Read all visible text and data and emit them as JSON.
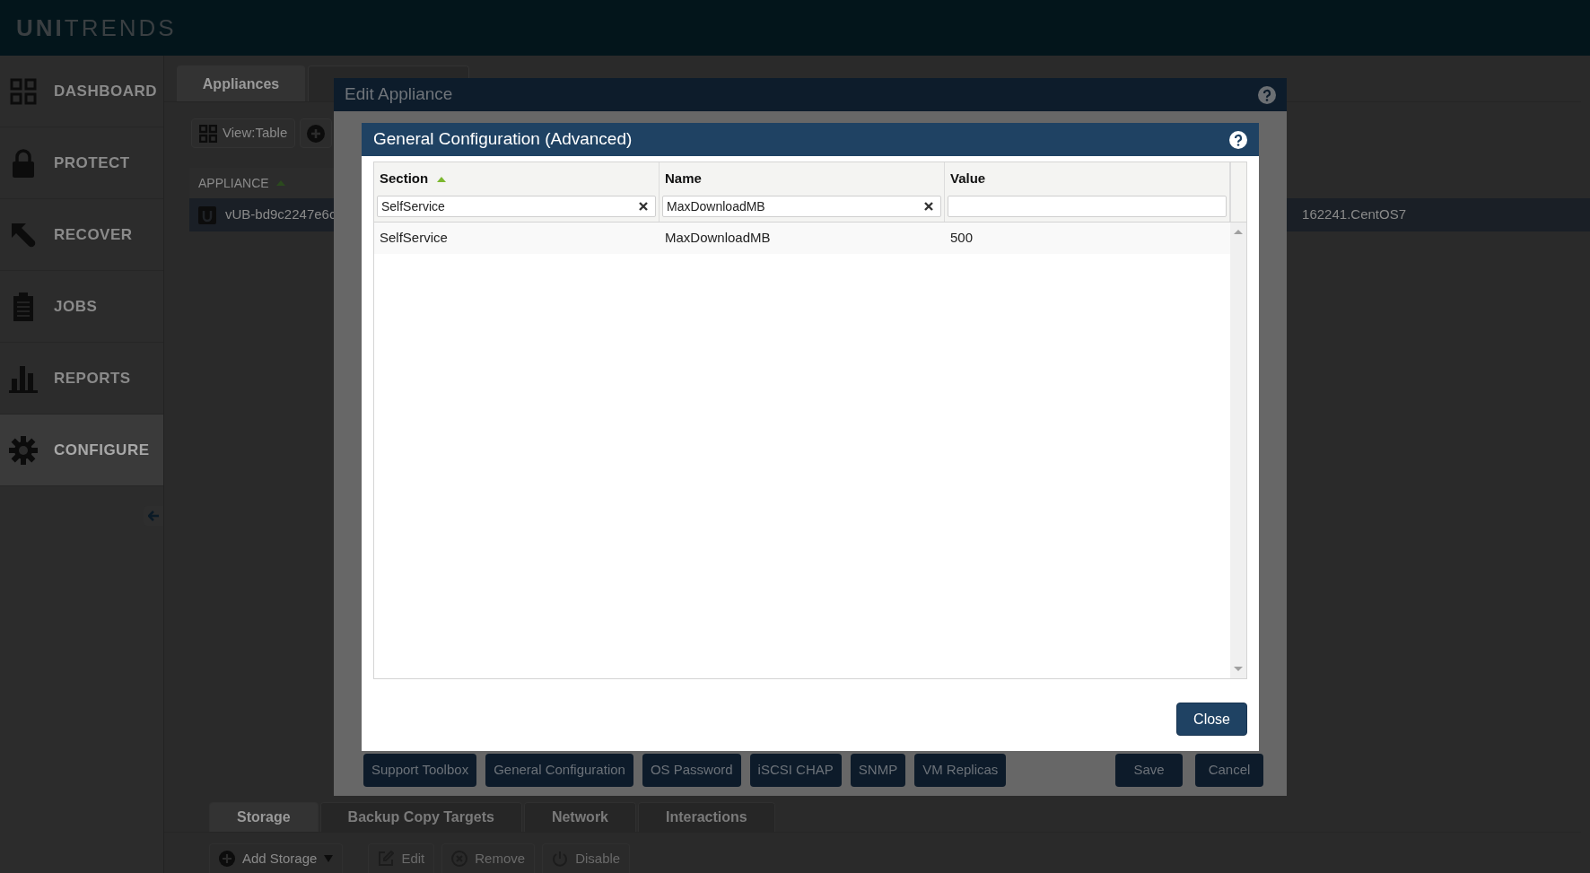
{
  "header": {
    "logo": "**UNI**TRENDS"
  },
  "sidebar": {
    "items": [
      {
        "label": "DASHBOARD",
        "selected": false
      },
      {
        "label": "PROTECT",
        "selected": false
      },
      {
        "label": "RECOVER",
        "selected": false
      },
      {
        "label": "JOBS",
        "selected": false
      },
      {
        "label": "REPORTS",
        "selected": false
      },
      {
        "label": "CONFIGURE",
        "selected": true
      }
    ]
  },
  "tabs": [
    {
      "label": "Appliances",
      "selected": true
    }
  ],
  "toolbar": {
    "view_button": "View:Table"
  },
  "appliance_table": {
    "column": "APPLIANCE",
    "rows": [
      {
        "name": "vUB-bd9c2247e6c",
        "name_end": "162241.CentOS7",
        "selected": true
      }
    ]
  },
  "bottom_tabs": [
    {
      "label": "Storage",
      "selected": true
    },
    {
      "label": "Backup Copy Targets",
      "selected": false
    },
    {
      "label": "Network",
      "selected": false
    },
    {
      "label": "Interactions",
      "selected": false
    }
  ],
  "bottom_toolbar": [
    {
      "label": "Add Storage",
      "kind": "add",
      "disabled": false
    },
    {
      "label": "Edit",
      "kind": "edit",
      "disabled": true
    },
    {
      "label": "Remove",
      "kind": "remove",
      "disabled": true
    },
    {
      "label": "Disable",
      "kind": "power",
      "disabled": true
    }
  ],
  "edit_dialog": {
    "title": "Edit Appliance",
    "buttons": [
      "Support Toolbox",
      "General Configuration",
      "OS Password",
      "iSCSI CHAP",
      "SNMP",
      "VM Replicas"
    ],
    "save": "Save",
    "cancel": "Cancel"
  },
  "config_dialog": {
    "title": "General Configuration (Advanced)",
    "columns": [
      {
        "label": "Section",
        "sorted": true
      },
      {
        "label": "Name",
        "sorted": false
      },
      {
        "label": "Value",
        "sorted": false
      }
    ],
    "filters": [
      {
        "value": "SelfService",
        "clearable": true
      },
      {
        "value": "MaxDownloadMB",
        "clearable": true
      },
      {
        "clearable": false
      }
    ],
    "rows": [
      [
        "SelfService",
        "MaxDownloadMB",
        "500"
      ]
    ],
    "close": "Close"
  }
}
